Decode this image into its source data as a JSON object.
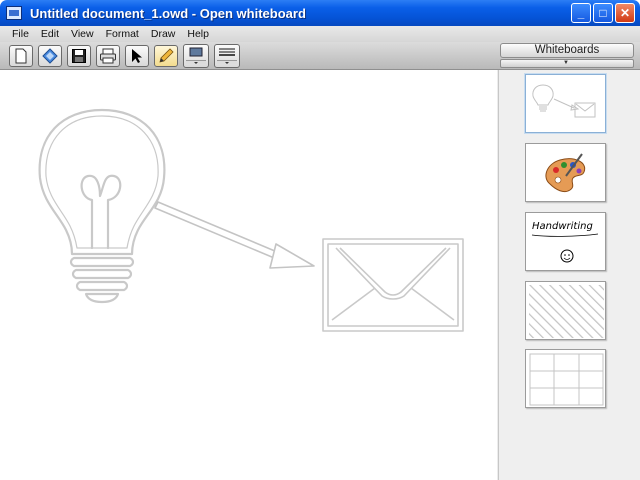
{
  "window": {
    "title": "Untitled document_1.owd - Open whiteboard"
  },
  "menu": [
    "File",
    "Edit",
    "View",
    "Format",
    "Draw",
    "Help"
  ],
  "toolbar": {
    "buttons": [
      "new-document",
      "eraser",
      "save",
      "print",
      "select-tool",
      "pen-tool",
      "fill-color",
      "line-style"
    ]
  },
  "sidebar": {
    "header": "Whiteboards",
    "thumbnails": [
      {
        "name": "lightbulb-envelope",
        "selected": true
      },
      {
        "name": "palette",
        "selected": false
      },
      {
        "name": "handwriting",
        "text": "Handwriting",
        "selected": false
      },
      {
        "name": "hatched",
        "selected": false
      },
      {
        "name": "grid",
        "selected": false
      }
    ]
  },
  "colors": {
    "titlebar": "#0553d6",
    "close": "#d13a14",
    "accent": "#8ab0d6"
  }
}
